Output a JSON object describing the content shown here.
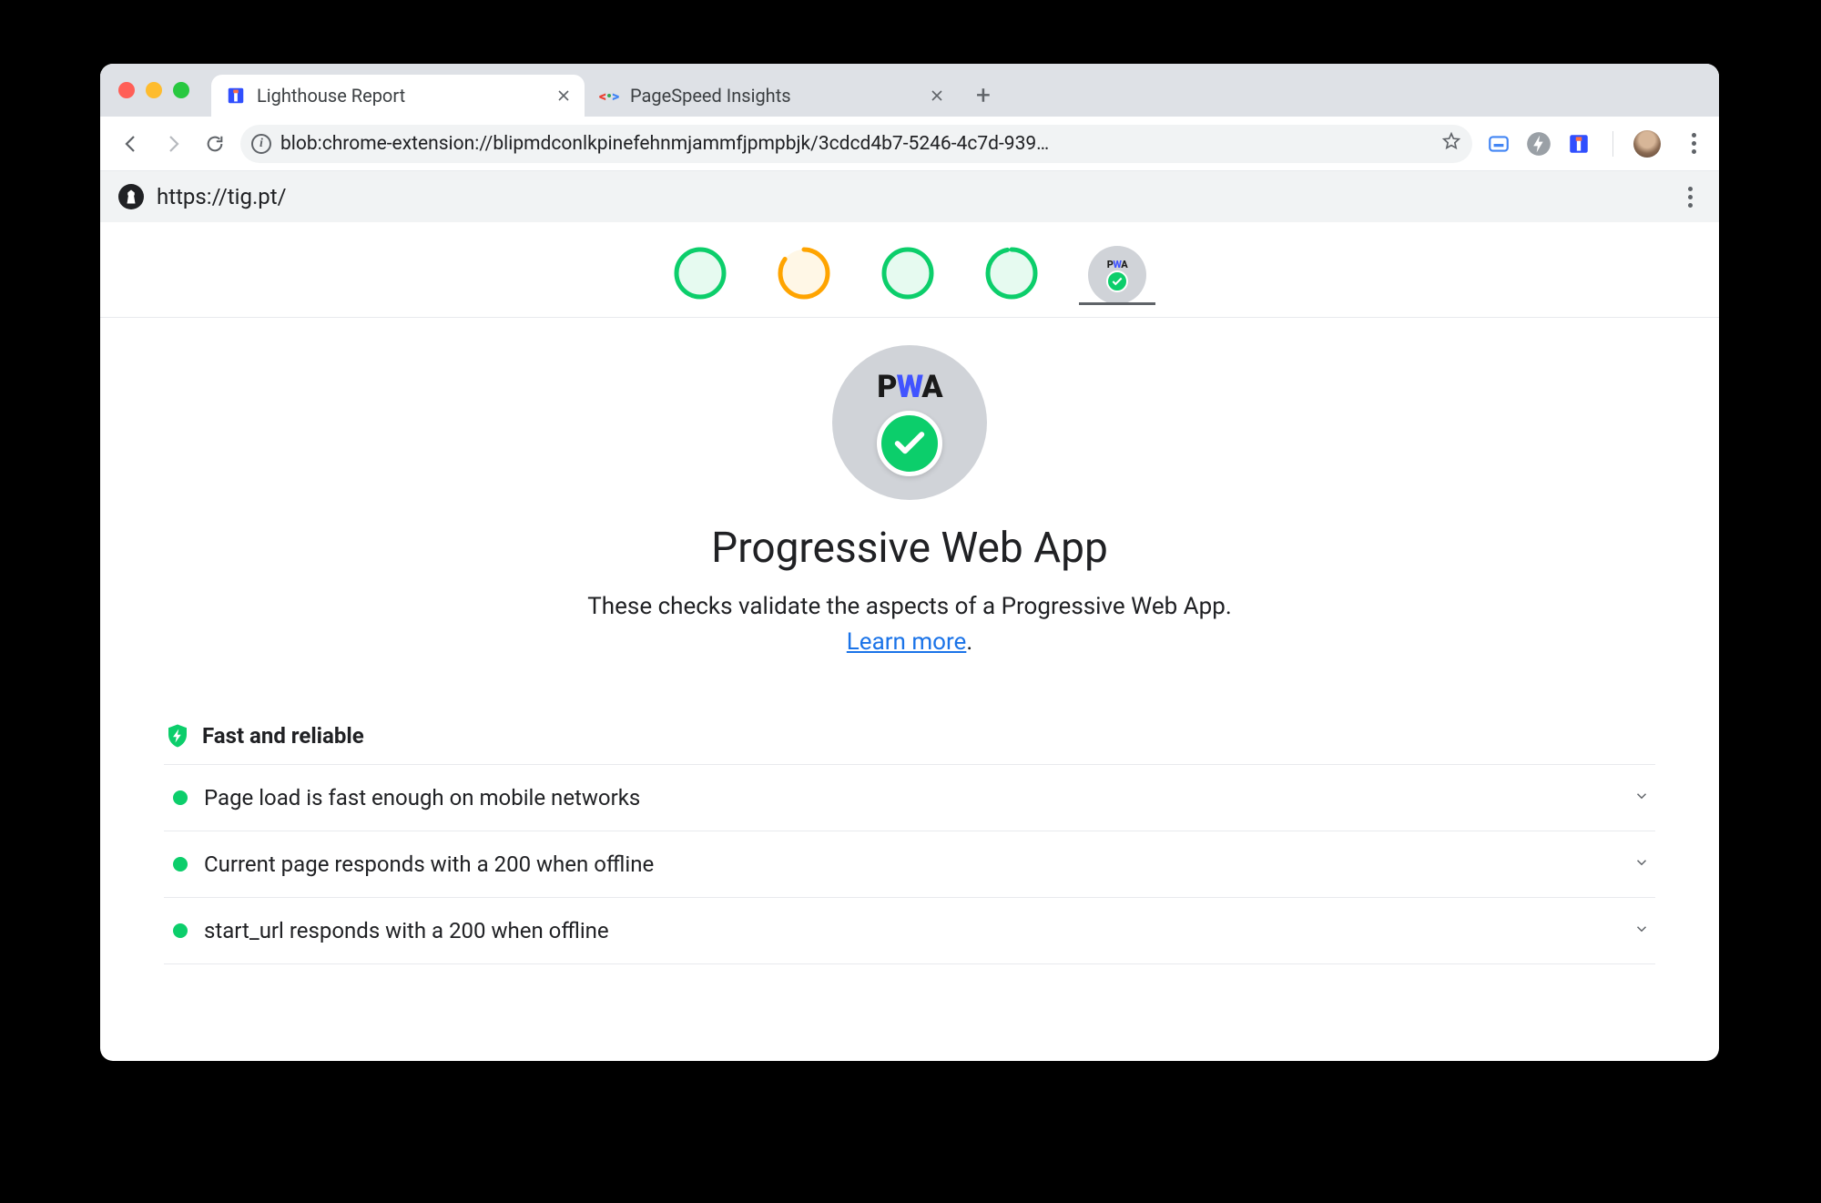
{
  "browser": {
    "tabs": [
      {
        "title": "Lighthouse Report",
        "active": true
      },
      {
        "title": "PageSpeed Insights",
        "active": false
      }
    ],
    "address": "blob:chrome-extension://blipmdconlkpinefehnmjammfjpmpbjk/3cdcd4b7-5246-4c7d-939…"
  },
  "report": {
    "url": "https://tig.pt/",
    "gauges": [
      {
        "id": "performance",
        "score": 99,
        "tier": "green",
        "pct": 99
      },
      {
        "id": "accessibility",
        "score": 85,
        "tier": "orange",
        "pct": 85
      },
      {
        "id": "best-practices",
        "score": 100,
        "tier": "green",
        "pct": 100
      },
      {
        "id": "seo",
        "score": 97,
        "tier": "green",
        "pct": 97
      }
    ],
    "pwa_selected": true
  },
  "hero": {
    "title": "Progressive Web App",
    "desc_prefix": "These checks validate the aspects of a Progressive Web App. ",
    "link_text": "Learn more",
    "desc_suffix": "."
  },
  "group": {
    "title": "Fast and reliable",
    "audits": [
      {
        "label": "Page load is fast enough on mobile networks"
      },
      {
        "label": "Current page responds with a 200 when offline"
      },
      {
        "label": "start_url responds with a 200 when offline"
      }
    ]
  }
}
